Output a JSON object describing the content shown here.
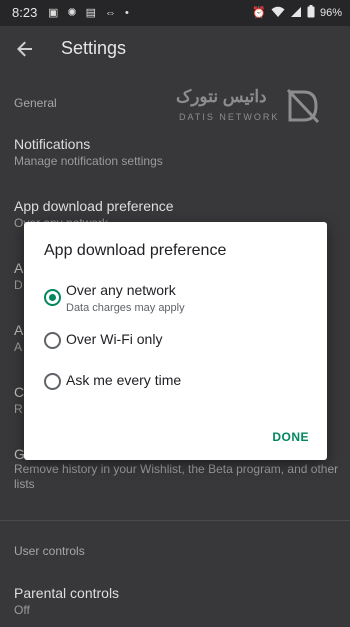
{
  "status_bar": {
    "time": "8:23",
    "left_icons": [
      "photo-icon",
      "brightness-icon",
      "news-icon",
      "media-icon",
      "dot-icon"
    ],
    "right_icons": [
      "alarm-icon",
      "wifi-icon",
      "signal-icon",
      "battery-icon"
    ],
    "battery": "96%"
  },
  "app_bar": {
    "title": "Settings"
  },
  "watermark": {
    "text_fa": "داتیس نتورک",
    "text_en": "DATIS NETWORK"
  },
  "settings": {
    "section_general": "General",
    "notifications_title": "Notifications",
    "notifications_sub": "Manage notification settings",
    "app_download_title": "App download preference",
    "app_download_sub": "Over any network",
    "obscured_1": "A",
    "obscured_1_sub": "D",
    "obscured_2": "A",
    "obscured_2_sub": "A",
    "obscured_3": "C",
    "obscured_3_sub": "R",
    "obscured_4": "G",
    "clear_history_sub": "Remove history in your Wishlist, the Beta program, and other lists",
    "section_user_controls": "User controls",
    "parental_title": "Parental controls",
    "parental_sub": "Off"
  },
  "dialog": {
    "title": "App download preference",
    "options": [
      {
        "label": "Over any network",
        "sub": "Data charges may apply",
        "checked": true
      },
      {
        "label": "Over Wi-Fi only",
        "sub": "",
        "checked": false
      },
      {
        "label": "Ask me every time",
        "sub": "",
        "checked": false
      }
    ],
    "done_label": "DONE"
  },
  "colors": {
    "accent": "#01875f",
    "background": "#38373a",
    "status_bar": "#262628",
    "dialog_bg": "#ffffff"
  }
}
